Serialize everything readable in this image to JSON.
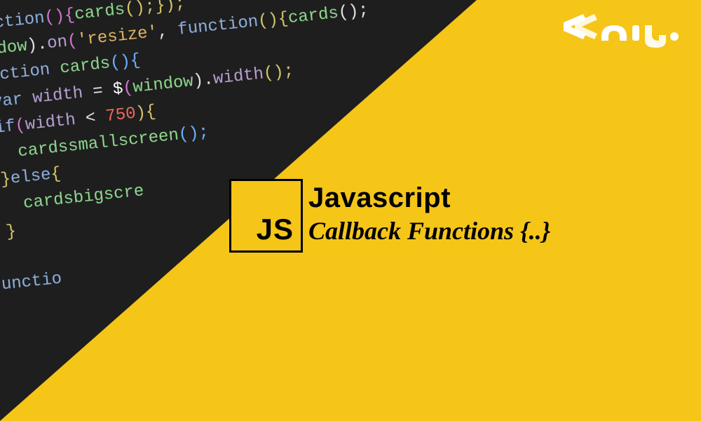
{
  "badge": {
    "label": "JS"
  },
  "heading": {
    "title": "Javascript",
    "subtitle": "Callback Functions {..}"
  },
  "code": {
    "line1": {
      "a": "$",
      "b": "(",
      "c": "function",
      "d": "(){",
      "e": "cards",
      "f": "();});"
    },
    "line2": {
      "a": "$",
      "b": "(",
      "c": "window",
      "d": ").",
      "e": "on",
      "f": "(",
      "g": "'resize'",
      "h": ", ",
      "i": "function",
      "j": "(){",
      "k": "cards",
      "l": "();"
    },
    "line3": {
      "a": "  ",
      "b": "function",
      "c": " ",
      "d": "cards",
      "e": "(){"
    },
    "line4": {
      "a": "    ",
      "b": "var",
      "c": " ",
      "d": "width",
      "e": " = ",
      "f": "$",
      "g": "(",
      "h": "window",
      "i": ").",
      "j": "width",
      "k": "();"
    },
    "line5": {
      "a": "    ",
      "b": "if",
      "c": "(",
      "d": "width",
      "e": " < ",
      "f": "750",
      "g": "){"
    },
    "line6": {
      "a": "      ",
      "b": "cardssmallscreen",
      "c": "();"
    },
    "line7": {
      "a": "    ",
      "b": "}",
      "c": "else",
      "d": "{"
    },
    "line8": {
      "a": "      ",
      "b": "cardsbigscre"
    },
    "line9": {
      "a": "    ",
      "b": "}"
    },
    "line10": {
      "a": "  ",
      "b": "}"
    },
    "line11": {
      "a": "  ",
      "b": "functio"
    },
    "line12": {
      "a": "  "
    }
  },
  "logo": {
    "alt": "سون لرن"
  }
}
